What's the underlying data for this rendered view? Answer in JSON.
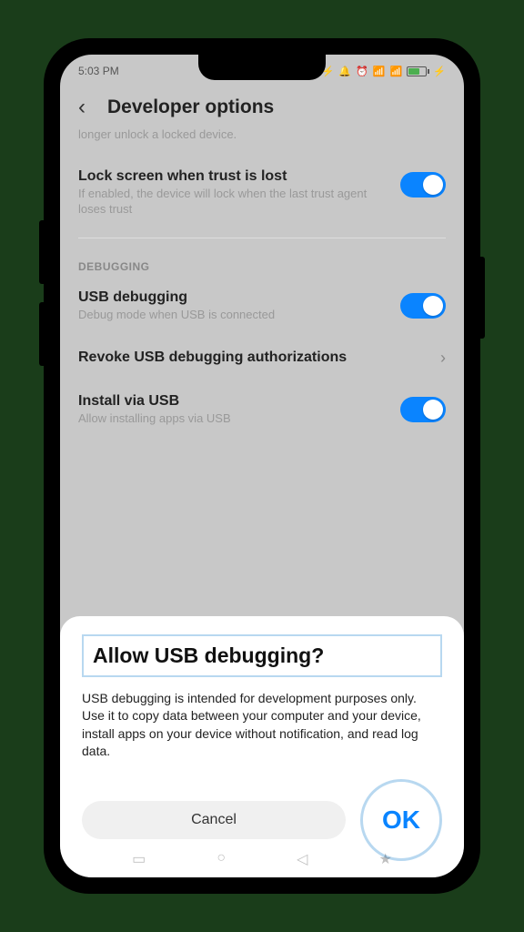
{
  "statusBar": {
    "time": "5:03 PM",
    "icons": "... ⚡ ⏰ ⚙ 📶 📶"
  },
  "header": {
    "title": "Developer options"
  },
  "partialRow": {
    "desc": "longer unlock a locked device."
  },
  "settings": {
    "lockScreen": {
      "title": "Lock screen when trust is lost",
      "desc": "If enabled, the device will lock when the last trust agent loses trust"
    },
    "sectionLabel": "DEBUGGING",
    "usbDebugging": {
      "title": "USB debugging",
      "desc": "Debug mode when USB is connected"
    },
    "revoke": {
      "title": "Revoke USB debugging authorizations"
    },
    "installUsb": {
      "title": "Install via USB",
      "desc": "Allow installing apps via USB"
    }
  },
  "dialog": {
    "title": "Allow USB debugging?",
    "body": "USB debugging is intended for development purposes only. Use it to copy data between your computer and your device, install apps on your device without notification, and read log data.",
    "cancel": "Cancel",
    "ok": "OK"
  }
}
